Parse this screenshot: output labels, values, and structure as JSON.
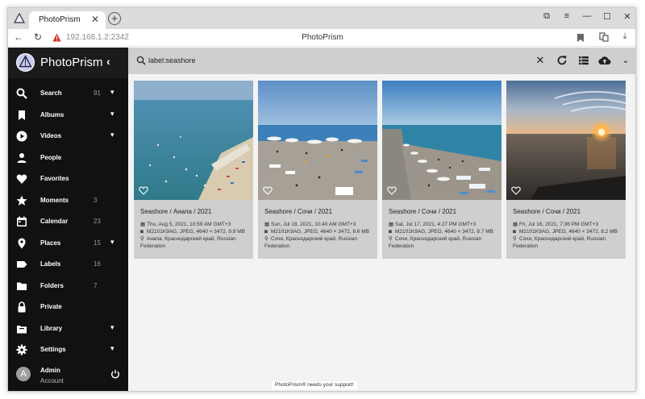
{
  "browser": {
    "tab_title": "PhotoPrism",
    "tab_close": "✕",
    "new_tab": "+",
    "url": "192.168.1.2:2342",
    "page_title": "PhotoPrism",
    "window_controls": [
      "⧉",
      "≡",
      "—",
      "☐",
      "✕"
    ]
  },
  "sidebar": {
    "brand": "PhotoPrism",
    "collapse_icon": "‹",
    "items": [
      {
        "label": "Search",
        "count": "91",
        "chevron": true,
        "icon": "search-icon"
      },
      {
        "label": "Albums",
        "count": "",
        "chevron": true,
        "icon": "bookmark-icon"
      },
      {
        "label": "Videos",
        "count": "",
        "chevron": true,
        "icon": "play-icon"
      },
      {
        "label": "People",
        "count": "",
        "chevron": false,
        "icon": "person-icon"
      },
      {
        "label": "Favorites",
        "count": "",
        "chevron": false,
        "icon": "heart-icon"
      },
      {
        "label": "Moments",
        "count": "3",
        "chevron": false,
        "icon": "star-icon"
      },
      {
        "label": "Calendar",
        "count": "23",
        "chevron": false,
        "icon": "calendar-icon"
      },
      {
        "label": "Places",
        "count": "15",
        "chevron": true,
        "icon": "location-pin-icon"
      },
      {
        "label": "Labels",
        "count": "16",
        "chevron": false,
        "icon": "label-icon"
      },
      {
        "label": "Folders",
        "count": "7",
        "chevron": false,
        "icon": "folder-icon"
      },
      {
        "label": "Private",
        "count": "",
        "chevron": false,
        "icon": "lock-icon"
      },
      {
        "label": "Library",
        "count": "",
        "chevron": true,
        "icon": "library-icon"
      },
      {
        "label": "Settings",
        "count": "",
        "chevron": true,
        "icon": "gear-icon"
      }
    ],
    "user": {
      "initial": "A",
      "name": "Admin",
      "subtitle": "Account"
    }
  },
  "toolbar": {
    "search_value": "label:seashore"
  },
  "cards": [
    {
      "title": "Seashore / Анапа / 2021",
      "date": "Thu, Aug 5, 2021, 10:59 AM GMT+3",
      "camera": "M2101K9AG, JPEG, 4640 × 3472, 9.9 MB",
      "location": "Анапа, Краснодарский край, Russian Federation"
    },
    {
      "title": "Seashore / Сочи / 2021",
      "date": "Sun, Jul 18, 2021, 10:40 AM GMT+3",
      "camera": "M2101K9AG, JPEG, 4640 × 3472, 9.6 MB",
      "location": "Сочи, Краснодарский край, Russian Federation"
    },
    {
      "title": "Seashore / Сочи / 2021",
      "date": "Sat, Jul 17, 2021, 4:27 PM GMT+3",
      "camera": "M2101K9AG, JPEG, 4640 × 3472, 8.7 MB",
      "location": "Сочи, Краснодарский край, Russian Federation"
    },
    {
      "title": "Seashore / Сочи / 2021",
      "date": "Fri, Jul 16, 2021, 7:36 PM GMT+3",
      "camera": "M2101K9AG, JPEG, 4640 × 3472, 8.2 MB",
      "location": "Сочи, Краснодарский край, Russian Federation"
    }
  ],
  "footer": "PhotoPrism® needs your support!",
  "colors": {
    "sidebar_bg": "#111111",
    "toolbar_bg": "#cfcfcf",
    "content_bg": "#f3f3f3",
    "card_bg": "#cfcfcf"
  }
}
